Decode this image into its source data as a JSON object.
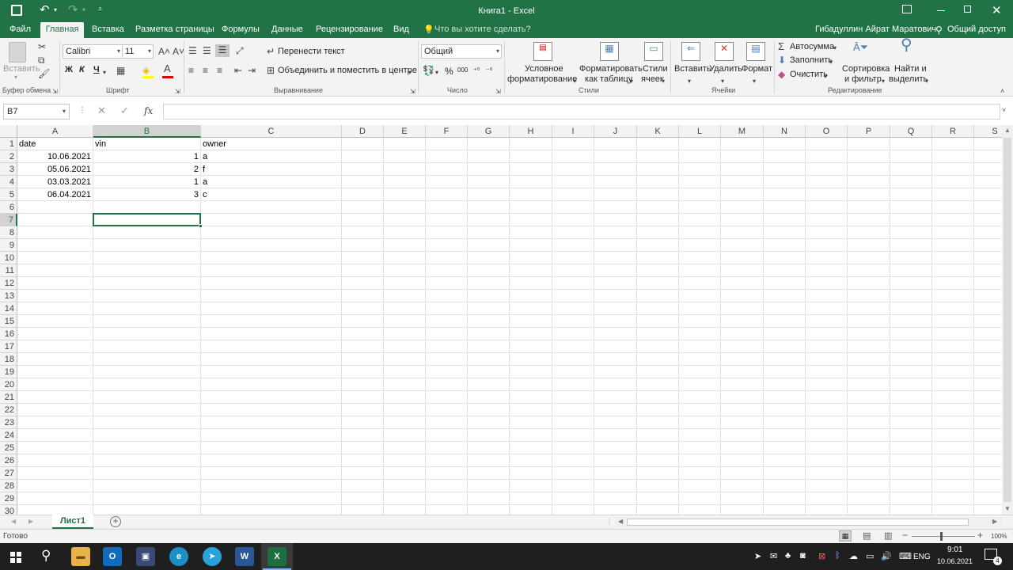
{
  "window": {
    "title": "Книга1 - Excel",
    "user": "Гибадуллин Айрат Маратович",
    "share_label": "Общий доступ",
    "tell_me_placeholder": "Что вы хотите сделать?"
  },
  "tabs": [
    {
      "label": "Файл"
    },
    {
      "label": "Главная"
    },
    {
      "label": "Вставка"
    },
    {
      "label": "Разметка страницы"
    },
    {
      "label": "Формулы"
    },
    {
      "label": "Данные"
    },
    {
      "label": "Рецензирование"
    },
    {
      "label": "Вид"
    }
  ],
  "ribbon": {
    "clipboard": {
      "paste": "Вставить",
      "label": "Буфер обмена"
    },
    "font": {
      "name": "Calibri",
      "size": "11",
      "bold": "Ж",
      "italic": "К",
      "underline": "Ч",
      "label": "Шрифт"
    },
    "alignment": {
      "wrap": "Перенести текст",
      "merge": "Объединить и поместить в центре",
      "label": "Выравнивание"
    },
    "number": {
      "format": "Общий",
      "percent": "%",
      "thousands": "000",
      "label": "Число"
    },
    "styles": {
      "conditional_line1": "Условное",
      "conditional_line2": "форматирование",
      "table_line1": "Форматировать",
      "table_line2": "как таблицу",
      "cell_styles_line1": "Стили",
      "cell_styles_line2": "ячеек",
      "label": "Стили"
    },
    "cells": {
      "insert": "Вставить",
      "delete": "Удалить",
      "format": "Формат",
      "label": "Ячейки"
    },
    "editing": {
      "autosum": "Автосумма",
      "fill": "Заполнить",
      "clear": "Очистить",
      "sort_line1": "Сортировка",
      "sort_line2": "и фильтр",
      "find_line1": "Найти и",
      "find_line2": "выделить",
      "label": "Редактирование"
    }
  },
  "formula_bar": {
    "name_box": "B7",
    "fx": "fx",
    "value": ""
  },
  "grid": {
    "columns": [
      "A",
      "B",
      "C",
      "D",
      "E",
      "F",
      "G",
      "H",
      "I",
      "J",
      "K",
      "L",
      "M",
      "N",
      "O",
      "P",
      "Q",
      "R",
      "S"
    ],
    "rows": [
      "1",
      "2",
      "3",
      "4",
      "5",
      "6",
      "7",
      "8",
      "9",
      "10",
      "11",
      "12",
      "13",
      "14",
      "15",
      "16",
      "17",
      "18",
      "19",
      "20",
      "21",
      "22",
      "23",
      "24",
      "25",
      "26",
      "27",
      "28",
      "29",
      "30"
    ],
    "selected_cell": "B7",
    "data": [
      [
        "date",
        "vin",
        "owner"
      ],
      [
        "10.06.2021",
        "1",
        "a"
      ],
      [
        "05.06.2021",
        "2",
        "f"
      ],
      [
        "03.03.2021",
        "1",
        "a"
      ],
      [
        "06.04.2021",
        "3",
        "c"
      ]
    ]
  },
  "sheet_tabs": [
    {
      "label": "Лист1"
    }
  ],
  "status": {
    "text": "Готово",
    "zoom": "100%"
  },
  "taskbar": {
    "time": "9:01",
    "date": "10.06.2021",
    "lang": "ENG",
    "notifications": "4"
  },
  "colors": {
    "accent": "#217346",
    "taskbar": "#1f1f1f"
  }
}
